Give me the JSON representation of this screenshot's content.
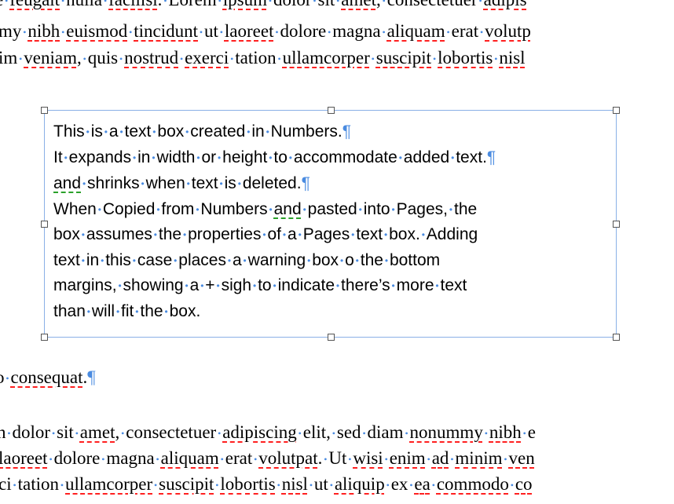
{
  "doc_lines_top": [
    "e feugait nulla facilisi. Lorem ipsum dolor sit amet, consectetuer adipis",
    "my nibh euismod tincidunt ut laoreet dolore magna aliquam erat volutp",
    "im veniam, quis nostrud exerci tation ullamcorper suscipit lobortis nisl"
  ],
  "doc_line_mid": "o consequat.",
  "doc_lines_bottom": [
    "n dolor sit amet, consectetuer adipiscing elit, sed diam nonummy nibh e",
    "laoreet dolore magna aliquam erat volutpat. Ut wisi enim ad minim ven",
    "ci tation ullamcorper suscipit lobortis nisl ut aliquip ex ea commodo co"
  ],
  "text_box_lines": [
    "This is a text box created in Numbers.",
    "It expands in width or height to accommodate added text.",
    "and shrinks when text is deleted.",
    "When Copied from Numbers and pasted into Pages, the",
    "box assumes the properties of a Pages text box. Adding",
    "text in this case places a warning box o the bottom",
    "margins, showing a + sigh to indicate there’s more text",
    "than will fit the box."
  ],
  "pilcrow": "¶",
  "space_dot": "•",
  "misspelled_words": [
    "feugait",
    "facilisi",
    "ipsum",
    "amet",
    "adipis",
    "nibh",
    "euismod",
    "tincidunt",
    "laoreet",
    "aliquam",
    "volutp",
    "veniam",
    "nostrud",
    "exerci",
    "ullamcorper",
    "suscipit",
    "lobortis",
    "nisl",
    "consequat",
    "adipiscing",
    "nonummy",
    "volutpat",
    "wisi",
    "enim",
    "ad",
    "minim",
    "ven",
    "aliquip",
    "ea",
    "commodo",
    "co"
  ],
  "grammar_words": [
    "and"
  ],
  "pilcrow_lines": [
    0,
    1,
    2
  ],
  "colors": {
    "invisibles": "#4a8be0",
    "spelling": "#ff2020",
    "grammar": "#2aa12a",
    "selection_border": "#8ab0e6"
  }
}
